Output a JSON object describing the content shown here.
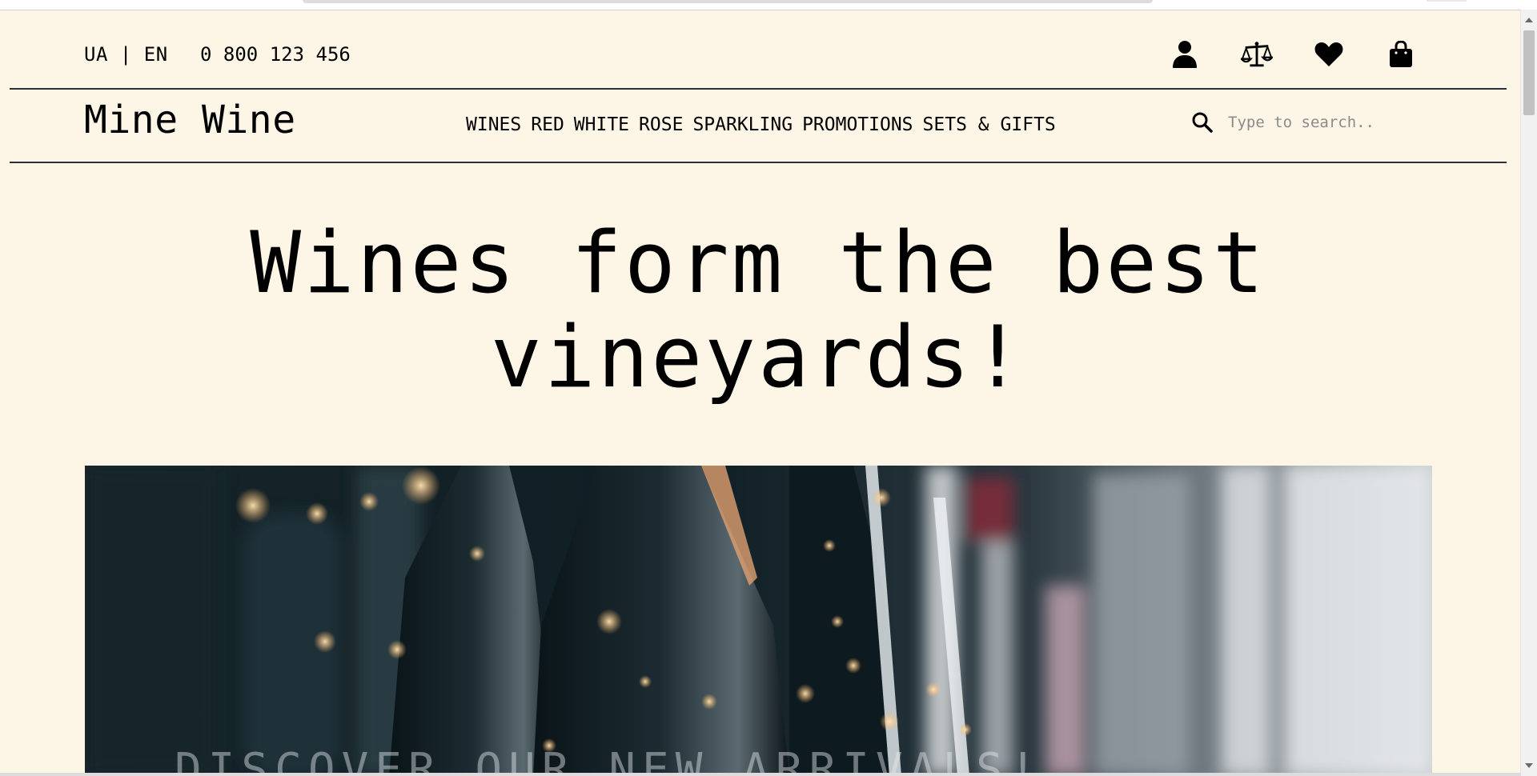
{
  "header": {
    "lang": "UA | EN",
    "phone": "0 800 123 456",
    "icons": [
      "user-icon",
      "compare-scale-icon",
      "heart-icon",
      "shopping-bag-icon"
    ]
  },
  "nav": {
    "logo": "Mine Wine",
    "menu": [
      "WINES",
      "RED",
      "WHITE",
      "ROSE",
      "SPARKLING",
      "PROMOTIONS",
      "SETS & GIFTS"
    ],
    "search_placeholder": "Type to search.."
  },
  "hero": {
    "title_line1": "Wines form the best",
    "title_line2": "vineyards!",
    "banner_text": "DISCOVER OUR NEW ARRIVALS!"
  },
  "colors": {
    "background": "#fdf6e7",
    "divider": "#2a2f3a",
    "text": "#000000"
  }
}
